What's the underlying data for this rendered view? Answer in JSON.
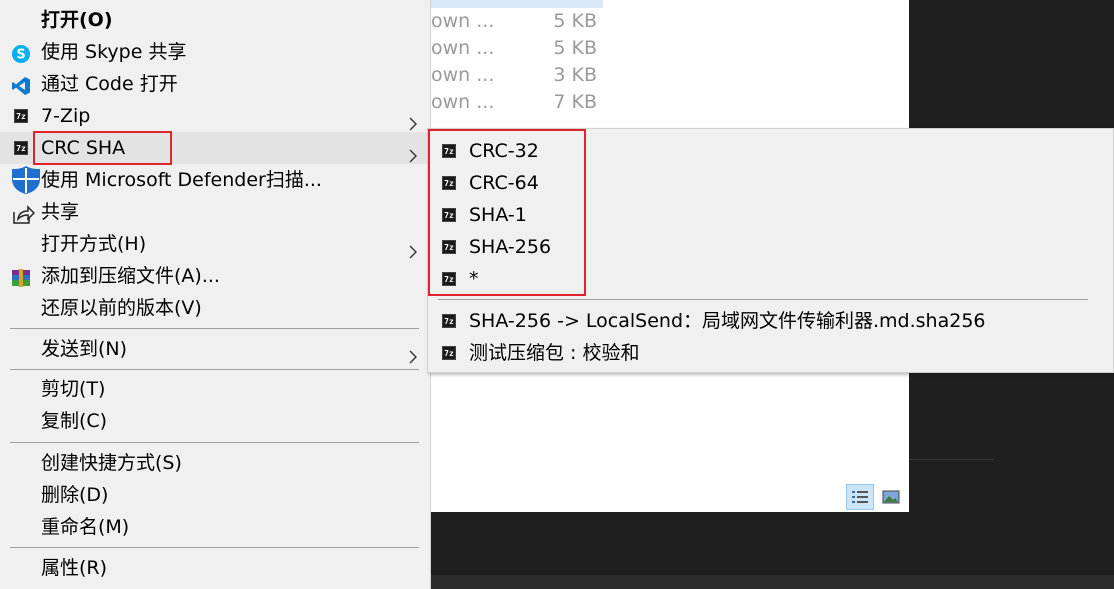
{
  "background": {
    "files": [
      {
        "name": "own ...",
        "size": "5 KB"
      },
      {
        "name": "own ...",
        "size": "5 KB"
      },
      {
        "name": "own ...",
        "size": "3 KB"
      },
      {
        "name": "own ...",
        "size": "7 KB"
      }
    ]
  },
  "menu": {
    "items": [
      {
        "label": "打开(O)"
      },
      {
        "label": "使用 Skype 共享",
        "icon": "skype-icon"
      },
      {
        "label": "通过 Code 打开",
        "icon": "vscode-icon"
      },
      {
        "label": "7-Zip",
        "icon": "7zip-icon"
      },
      {
        "label": "CRC SHA",
        "icon": "7zip-icon"
      },
      {
        "label": "使用 Microsoft Defender扫描...",
        "icon": "defender-shield-icon"
      },
      {
        "label": "共享",
        "icon": "share-icon"
      },
      {
        "label": "打开方式(H)"
      },
      {
        "label": "添加到压缩文件(A)...",
        "icon": "winrar-icon"
      },
      {
        "label": "还原以前的版本(V)"
      },
      {
        "label": "发送到(N)"
      },
      {
        "label": "剪切(T)"
      },
      {
        "label": "复制(C)"
      },
      {
        "label": "创建快捷方式(S)"
      },
      {
        "label": "删除(D)"
      },
      {
        "label": "重命名(M)"
      },
      {
        "label": "属性(R)"
      }
    ]
  },
  "submenu": {
    "items": [
      {
        "label": "CRC-32"
      },
      {
        "label": "CRC-64"
      },
      {
        "label": "SHA-1"
      },
      {
        "label": "SHA-256"
      },
      {
        "label": "*"
      },
      {
        "label": "SHA-256 -> LocalSend：局域网文件传输利器.md.sha256"
      },
      {
        "label": "测试压缩包 : 校验和"
      }
    ]
  },
  "colors": {
    "menu_bg": "#f0f0f0",
    "highlight_box": "#e0242b",
    "hover": "#e3e3e3"
  }
}
